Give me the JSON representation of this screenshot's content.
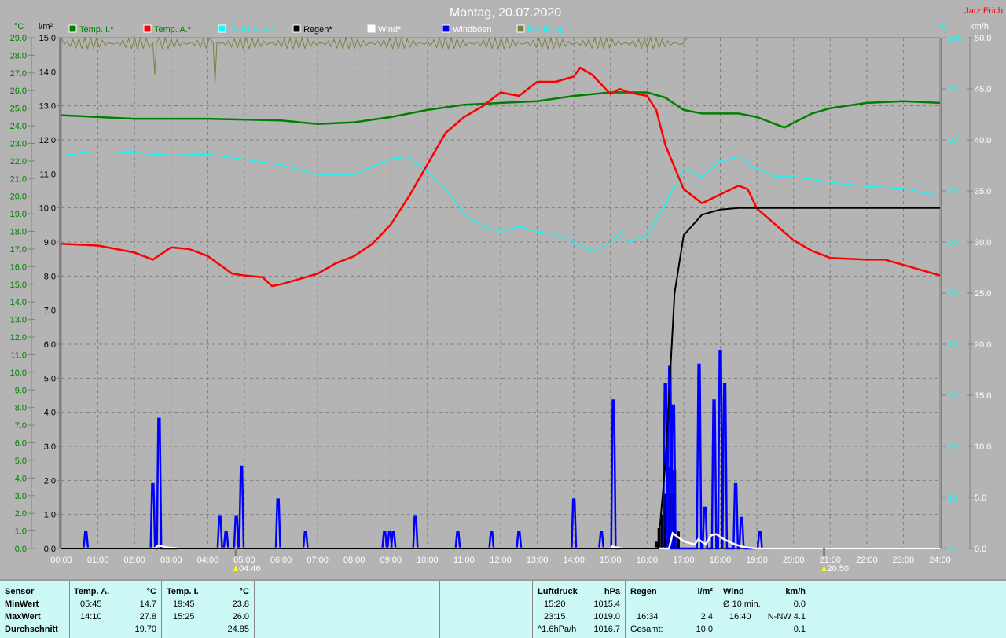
{
  "title": "Montag, 20.07.2020",
  "author": "Jarz Erich",
  "legend": [
    {
      "label": "Temp. I.*",
      "color": "#008000",
      "text_color": "#008000"
    },
    {
      "label": "Temp. A.*",
      "color": "#ff0000",
      "text_color": "#008000"
    },
    {
      "label": "Feuchte A.*",
      "color": "#00ffff",
      "text_color": "#00ffff"
    },
    {
      "label": "Regen*",
      "color": "#000000",
      "text_color": "#000000"
    },
    {
      "label": "Wind*",
      "color": "#ffffff",
      "text_color": "#ffffff"
    },
    {
      "label": "Windböen",
      "color": "#0000ff",
      "text_color": "#ffffff"
    },
    {
      "label": "Empfang",
      "color": "#808040",
      "text_color": "#00ffff"
    }
  ],
  "colors": {
    "temp_i": "#008000",
    "temp_a": "#ff0000",
    "humidity": "#00ffff",
    "rain": "#000000",
    "wind": "#ffffff",
    "gust": "#0000ff",
    "reception": "#808040"
  },
  "sun": {
    "sunrise": "04:46",
    "sunset": "20:50"
  },
  "chart_data": {
    "type": "line",
    "title": "Montag, 20.07.2020",
    "x_unit": "hours",
    "x_range": [
      0,
      24
    ],
    "x_ticks": [
      "00:00",
      "01:00",
      "02:00",
      "03:00",
      "04:00",
      "05:00",
      "06:00",
      "07:00",
      "08:00",
      "09:00",
      "10:00",
      "11:00",
      "12:00",
      "13:00",
      "14:00",
      "15:00",
      "16:00",
      "17:00",
      "18:00",
      "19:00",
      "20:00",
      "21:00",
      "22:00",
      "23:00",
      "24:00"
    ],
    "axes": {
      "temp": {
        "label": "°C",
        "range": [
          0,
          29
        ],
        "step": 1
      },
      "rain": {
        "label": "l/m²",
        "range": [
          0,
          15
        ],
        "step": 1
      },
      "humidity": {
        "label": "%",
        "range": [
          0,
          100
        ],
        "step": 10
      },
      "wind": {
        "label": "km/h",
        "range": [
          0,
          50
        ],
        "step": 5
      }
    },
    "grid": true,
    "series": [
      {
        "name": "Temp. I.*",
        "axis": "temp",
        "points": [
          [
            0,
            24.6
          ],
          [
            2,
            24.4
          ],
          [
            4,
            24.4
          ],
          [
            6,
            24.3
          ],
          [
            7,
            24.1
          ],
          [
            8,
            24.2
          ],
          [
            9,
            24.5
          ],
          [
            10,
            24.9
          ],
          [
            11,
            25.2
          ],
          [
            12,
            25.3
          ],
          [
            13,
            25.4
          ],
          [
            14,
            25.7
          ],
          [
            15,
            25.9
          ],
          [
            16,
            25.9
          ],
          [
            16.5,
            25.6
          ],
          [
            17,
            24.9
          ],
          [
            17.5,
            24.7
          ],
          [
            18.5,
            24.7
          ],
          [
            19,
            24.5
          ],
          [
            19.75,
            23.9
          ],
          [
            20.5,
            24.7
          ],
          [
            21,
            25.0
          ],
          [
            22,
            25.3
          ],
          [
            23,
            25.4
          ],
          [
            24,
            25.3
          ]
        ]
      },
      {
        "name": "Temp. A.*",
        "axis": "temp",
        "points": [
          [
            0,
            17.3
          ],
          [
            1,
            17.2
          ],
          [
            2,
            16.8
          ],
          [
            2.5,
            16.4
          ],
          [
            3,
            17.1
          ],
          [
            3.5,
            17.0
          ],
          [
            4,
            16.6
          ],
          [
            4.67,
            15.6
          ],
          [
            5,
            15.5
          ],
          [
            5.5,
            15.4
          ],
          [
            5.75,
            14.9
          ],
          [
            6,
            15.0
          ],
          [
            6.5,
            15.3
          ],
          [
            7,
            15.6
          ],
          [
            7.5,
            16.2
          ],
          [
            8,
            16.6
          ],
          [
            8.5,
            17.3
          ],
          [
            9,
            18.4
          ],
          [
            9.5,
            20.0
          ],
          [
            10,
            21.8
          ],
          [
            10.5,
            23.6
          ],
          [
            11,
            24.5
          ],
          [
            11.5,
            25.1
          ],
          [
            12,
            25.9
          ],
          [
            12.5,
            25.7
          ],
          [
            13,
            26.5
          ],
          [
            13.5,
            26.5
          ],
          [
            14,
            26.8
          ],
          [
            14.17,
            27.3
          ],
          [
            14.5,
            26.9
          ],
          [
            15,
            25.8
          ],
          [
            15.25,
            26.1
          ],
          [
            15.5,
            25.9
          ],
          [
            16,
            25.7
          ],
          [
            16.25,
            24.9
          ],
          [
            16.5,
            22.9
          ],
          [
            17,
            20.4
          ],
          [
            17.5,
            19.6
          ],
          [
            18,
            20.1
          ],
          [
            18.5,
            20.6
          ],
          [
            18.75,
            20.4
          ],
          [
            19,
            19.3
          ],
          [
            19.5,
            18.4
          ],
          [
            20,
            17.5
          ],
          [
            20.5,
            16.9
          ],
          [
            21,
            16.5
          ],
          [
            22,
            16.4
          ],
          [
            22.5,
            16.4
          ],
          [
            23,
            16.1
          ],
          [
            24,
            15.5
          ]
        ]
      },
      {
        "name": "Feuchte A.*",
        "axis": "humidity",
        "points": [
          [
            0,
            76.9
          ],
          [
            1,
            77.8
          ],
          [
            2,
            77.4
          ],
          [
            3,
            77.0
          ],
          [
            4,
            77.2
          ],
          [
            5,
            76.2
          ],
          [
            6,
            75.1
          ],
          [
            7,
            73.2
          ],
          [
            8,
            73.2
          ],
          [
            9,
            76.3
          ],
          [
            9.5,
            76.6
          ],
          [
            10,
            73.8
          ],
          [
            10.5,
            70.5
          ],
          [
            11,
            65.5
          ],
          [
            11.5,
            63.1
          ],
          [
            12,
            62.0
          ],
          [
            12.5,
            63.1
          ],
          [
            13,
            62.0
          ],
          [
            13.5,
            61.5
          ],
          [
            14,
            60.0
          ],
          [
            14.5,
            58.2
          ],
          [
            15,
            59.7
          ],
          [
            15.25,
            62.0
          ],
          [
            15.5,
            60.0
          ],
          [
            16,
            61.2
          ],
          [
            16.5,
            67.4
          ],
          [
            17,
            74.3
          ],
          [
            17.5,
            72.8
          ],
          [
            18,
            75.8
          ],
          [
            18.5,
            76.6
          ],
          [
            19,
            74.3
          ],
          [
            19.5,
            72.8
          ],
          [
            20,
            72.8
          ],
          [
            21,
            71.7
          ],
          [
            22,
            70.9
          ],
          [
            23,
            70.5
          ],
          [
            24,
            68.9
          ]
        ]
      },
      {
        "name": "Regen* (Summe)",
        "axis": "rain",
        "points": [
          [
            0,
            0
          ],
          [
            16.3,
            0
          ],
          [
            16.5,
            2.5
          ],
          [
            16.65,
            5.5
          ],
          [
            16.75,
            7.5
          ],
          [
            17,
            9.2
          ],
          [
            17.5,
            9.8
          ],
          [
            18,
            9.95
          ],
          [
            18.5,
            10.0
          ],
          [
            24,
            10.0
          ]
        ]
      },
      {
        "name": "Wind*",
        "axis": "wind",
        "points": [
          [
            0,
            0
          ],
          [
            2.55,
            0
          ],
          [
            2.65,
            0.3
          ],
          [
            2.9,
            0.1
          ],
          [
            3.2,
            0
          ],
          [
            15,
            0
          ],
          [
            15.05,
            0.2
          ],
          [
            15.3,
            0
          ],
          [
            16.6,
            0
          ],
          [
            16.7,
            1.5
          ],
          [
            17,
            0.7
          ],
          [
            17.3,
            0.4
          ],
          [
            17.4,
            0.9
          ],
          [
            17.6,
            0.4
          ],
          [
            17.75,
            1.3
          ],
          [
            17.9,
            1.4
          ],
          [
            18.1,
            0.9
          ],
          [
            18.4,
            0.4
          ],
          [
            18.7,
            0.1
          ],
          [
            19,
            0
          ],
          [
            24,
            0
          ]
        ]
      },
      {
        "name": "Windböen",
        "axis": "wind",
        "spikes": [
          [
            0.67,
            1.6
          ],
          [
            2.5,
            6.3
          ],
          [
            2.67,
            12.7
          ],
          [
            4.33,
            3.1
          ],
          [
            4.5,
            1.6
          ],
          [
            4.78,
            3.1
          ],
          [
            4.92,
            8.0
          ],
          [
            5.92,
            4.8
          ],
          [
            6.67,
            1.6
          ],
          [
            8.83,
            1.6
          ],
          [
            8.97,
            1.6
          ],
          [
            9.07,
            1.6
          ],
          [
            9.67,
            3.1
          ],
          [
            10.83,
            1.6
          ],
          [
            11.75,
            1.6
          ],
          [
            12.5,
            1.6
          ],
          [
            14,
            4.8
          ],
          [
            14.75,
            1.6
          ],
          [
            15.08,
            14.5
          ],
          [
            16.5,
            16.1
          ],
          [
            16.62,
            17.8
          ],
          [
            16.72,
            14.0
          ],
          [
            17.42,
            18.0
          ],
          [
            17.58,
            4.0
          ],
          [
            17.83,
            14.5
          ],
          [
            18.0,
            19.3
          ],
          [
            18.12,
            16.1
          ],
          [
            18.42,
            6.3
          ],
          [
            18.58,
            3.0
          ],
          [
            19.08,
            1.6
          ]
        ]
      },
      {
        "name": "Regen* (Intervall)",
        "axis": "rain",
        "bars": [
          [
            16.25,
            0.2
          ],
          [
            16.33,
            0.6
          ],
          [
            16.42,
            1.0
          ],
          [
            16.5,
            1.6
          ],
          [
            16.57,
            2.4
          ],
          [
            16.67,
            1.6
          ],
          [
            16.75,
            2.3
          ],
          [
            16.85,
            0.5
          ]
        ]
      },
      {
        "name": "Empfang",
        "axis": "humidity",
        "points": [
          [
            0,
            100
          ],
          [
            2.5,
            99
          ],
          [
            2.55,
            92.8
          ],
          [
            2.6,
            99
          ],
          [
            4.15,
            99
          ],
          [
            4.2,
            91
          ],
          [
            4.25,
            99
          ],
          [
            17,
            99
          ],
          [
            17.1,
            100
          ],
          [
            24,
            100
          ]
        ]
      }
    ]
  },
  "stats": {
    "sensor": {
      "header": "Sensor",
      "rows": [
        "MinWert",
        "MaxWert",
        "Durchschnitt"
      ]
    },
    "temp_a": {
      "header": "Temp. A.",
      "unit": "°C",
      "min_time": "05:45",
      "min": "14.7",
      "max_time": "14:10",
      "max": "27.8",
      "avg": "19.70"
    },
    "temp_i": {
      "header": "Temp. I.",
      "unit": "°C",
      "min_time": "19:45",
      "min": "23.8",
      "max_time": "15:25",
      "max": "26.0",
      "avg": "24.85"
    },
    "pressure": {
      "header": "Luftdruck",
      "unit": "hPa",
      "r1_label": "15:20",
      "r1": "1015.4",
      "r2_label": "23:15",
      "r2": "1019.0",
      "r3_label": "^1.6hPa/h",
      "r3": "1016.7"
    },
    "rain": {
      "header": "Regen",
      "unit": "l/m²",
      "r2_label": "16:34",
      "r2": "2.4",
      "r3_label": "Gesamt:",
      "r3": "10.0"
    },
    "wind": {
      "header": "Wind",
      "unit": "km/h",
      "r1_label": "Ø 10 min.",
      "r1": "0.0",
      "r2_label": "16:40",
      "r2": "N-NW 4.1",
      "r3": "0.1"
    }
  }
}
